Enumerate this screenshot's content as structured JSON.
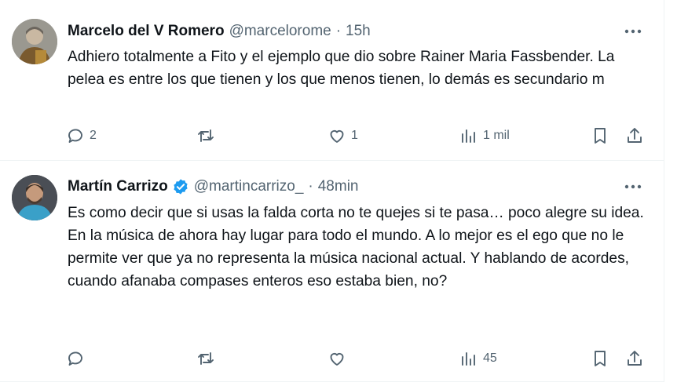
{
  "tweets": [
    {
      "author_name": "Marcelo del V Romero",
      "handle": "@marcelorome",
      "separator": "·",
      "time": "15h",
      "verified": false,
      "text_paragraphs": [
        "Adhiero totalmente a Fito y el ejemplo que dio sobre Rainer Maria Fassbender. La pelea es entre los que tienen y los que menos tienen, lo demás es secundario m"
      ],
      "replies": "2",
      "retweets": "",
      "likes": "1",
      "views": "1 mil",
      "icons": [
        "reply-icon",
        "retweet-icon",
        "like-icon",
        "views-icon",
        "bookmark-icon",
        "share-icon",
        "more-icon"
      ]
    },
    {
      "author_name": "Martín Carrizo",
      "handle": "@martincarrizo_",
      "separator": "·",
      "time": "48min",
      "verified": true,
      "verified_color": "#1d9bf0",
      "text_paragraphs": [
        "Es como decir que si usas la falda corta no te quejes si te pasa… poco alegre su idea.",
        "En la música de ahora hay lugar para todo el mundo. A lo mejor es el ego que no le permite ver que ya no representa la música nacional actual. Y hablando de acordes, cuando afanaba compases enteros eso estaba bien, no?"
      ],
      "replies": "",
      "retweets": "",
      "likes": "",
      "views": "45",
      "icons": [
        "reply-icon",
        "retweet-icon",
        "like-icon",
        "views-icon",
        "bookmark-icon",
        "share-icon",
        "more-icon"
      ]
    }
  ],
  "colors": {
    "text": "#0f1419",
    "secondary": "#536471",
    "divider": "#eff3f4",
    "verified": "#1d9bf0"
  }
}
